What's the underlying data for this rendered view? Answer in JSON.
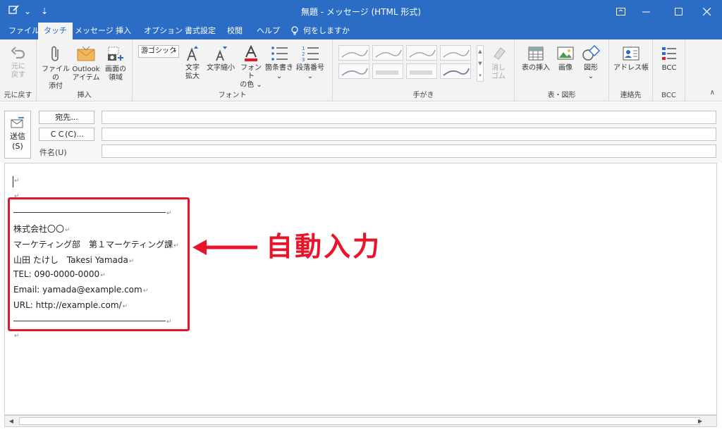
{
  "window": {
    "title": "無題  -  メッセージ (HTML 形式)",
    "qat_dropdown": "⌄",
    "qat_more": "⇣"
  },
  "tabs": [
    {
      "label": "ファイル"
    },
    {
      "label": "タッチ"
    },
    {
      "label": "メッセージ"
    },
    {
      "label": "挿入"
    },
    {
      "label": "オプション"
    },
    {
      "label": "書式設定"
    },
    {
      "label": "校閲"
    },
    {
      "label": "ヘルプ"
    },
    {
      "label": "何をしますか"
    }
  ],
  "ribbon": {
    "undo": {
      "line1": "元に",
      "line2": "戻す",
      "group": "元に戻す"
    },
    "insert": {
      "group": "挿入",
      "attach": {
        "line1": "ファイルの",
        "line2": "添付"
      },
      "outlook": {
        "line1": "Outlook",
        "line2": "アイテム"
      },
      "screen": {
        "line1": "画面の",
        "line2": "領域"
      }
    },
    "font": {
      "group": "フォント",
      "font_name": "游ゴシック",
      "grow": {
        "line1": "文字",
        "line2": "拡大"
      },
      "shrink": {
        "line1": "文字縮小"
      },
      "color": {
        "line1": "フォント",
        "line2": "の色 ⌄"
      },
      "bullets": {
        "line1": "箇条書き",
        "line2": "⌄"
      },
      "numbering": {
        "line1": "段落番号",
        "line2": "⌄"
      }
    },
    "ink": {
      "group": "手がき",
      "eraser": {
        "line1": "消し",
        "line2": "ゴム"
      }
    },
    "tables": {
      "group": "表・図形",
      "table": {
        "line1": "表の挿入"
      },
      "picture": {
        "line1": "画像"
      },
      "shapes": {
        "line1": "図形",
        "line2": "⌄"
      }
    },
    "contacts": {
      "group": "連絡先",
      "book": {
        "line1": "アドレス帳"
      }
    },
    "bcc": {
      "group": "BCC",
      "btn": {
        "line1": "BCC"
      }
    }
  },
  "header": {
    "send": {
      "line1": "送信",
      "line2": "(S)"
    },
    "to_label": "宛先...",
    "cc_label": "ＣＣ(C)...",
    "subject_label": "件名(U)"
  },
  "body": {
    "pilcrow": "↵",
    "signature": [
      "――――――――――――――――――",
      "株式会社〇〇",
      "マーケティング部　第１マーケティング課",
      "山田 たけし　Takesi Yamada",
      "TEL: 090-0000-0000",
      "Email: yamada@example.com",
      "URL: http://example.com/",
      "――――――――――――――――――"
    ],
    "annotation": "自動入力"
  },
  "colors": {
    "titlebar": "#2b6cc4",
    "ribbon_bg": "#f3f3f3",
    "annotation_red": "#e8142a"
  }
}
